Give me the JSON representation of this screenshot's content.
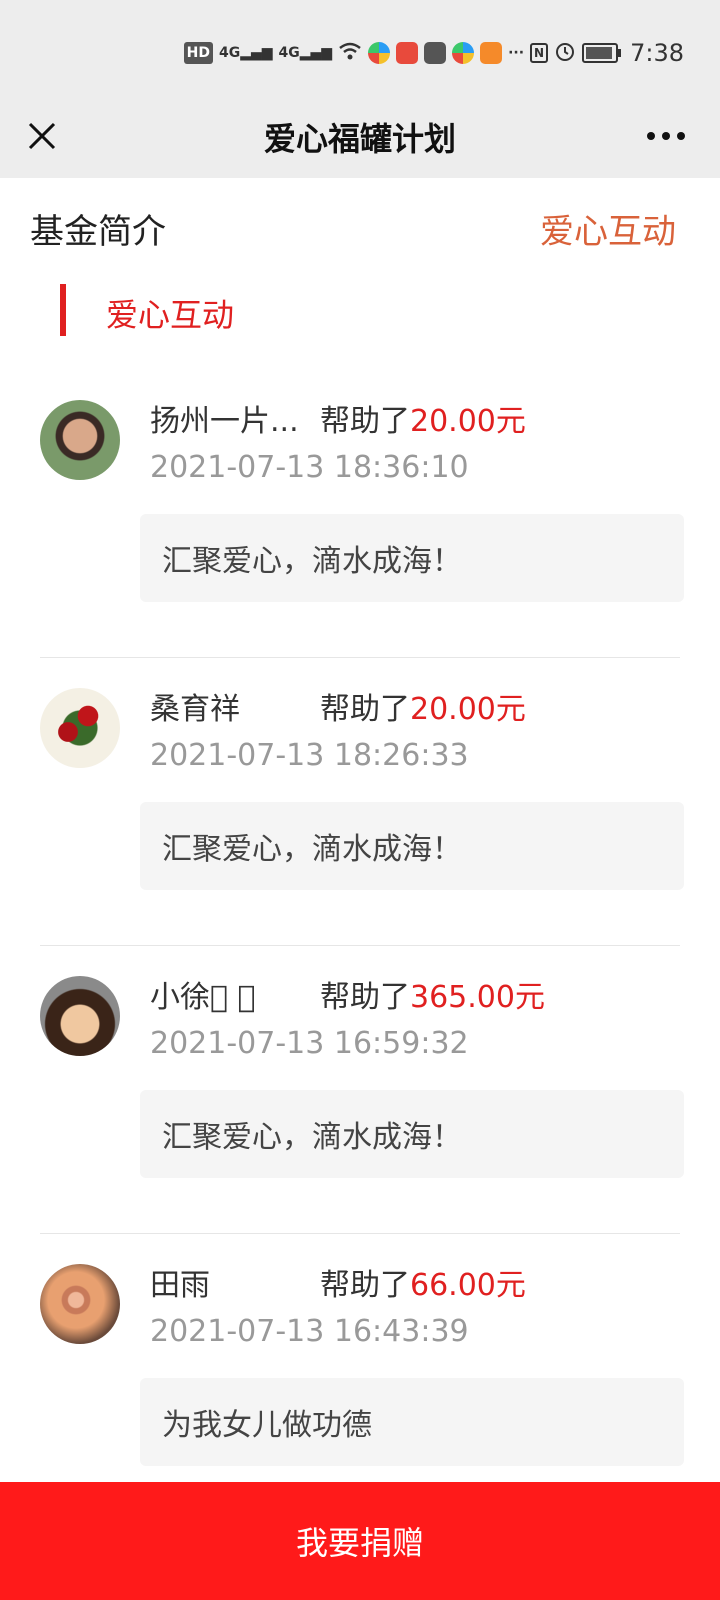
{
  "status_bar": {
    "network_hd": "HD",
    "signal1": "4G",
    "signal2": "4G",
    "time": "7:38"
  },
  "title_bar": {
    "title": "爱心福罐计划"
  },
  "tabs": {
    "intro_label": "基金简介",
    "interaction_label": "爱心互动"
  },
  "section": {
    "title": "爱心互动"
  },
  "entries": [
    {
      "name": "扬州一片...",
      "helped_prefix": "帮助了",
      "amount": "20.00元",
      "time": "2021-07-13 18:36:10",
      "message": "汇聚爱心，滴水成海！"
    },
    {
      "name": "桑育祥",
      "helped_prefix": "帮助了",
      "amount": "20.00元",
      "time": "2021-07-13 18:26:33",
      "message": "汇聚爱心，滴水成海！"
    },
    {
      "name": "小徐􀀀 􀀀",
      "helped_prefix": "帮助了",
      "amount": "365.00元",
      "time": "2021-07-13 16:59:32",
      "message": "汇聚爱心，滴水成海！"
    },
    {
      "name": "田雨",
      "helped_prefix": "帮助了",
      "amount": "66.00元",
      "time": "2021-07-13 16:43:39",
      "message": "为我女儿做功德"
    }
  ],
  "donate_button": {
    "label": "我要捐赠"
  },
  "colors": {
    "accent_red": "#e02020",
    "tab_orange": "#d9623a",
    "button_red": "#ff1a1a"
  }
}
